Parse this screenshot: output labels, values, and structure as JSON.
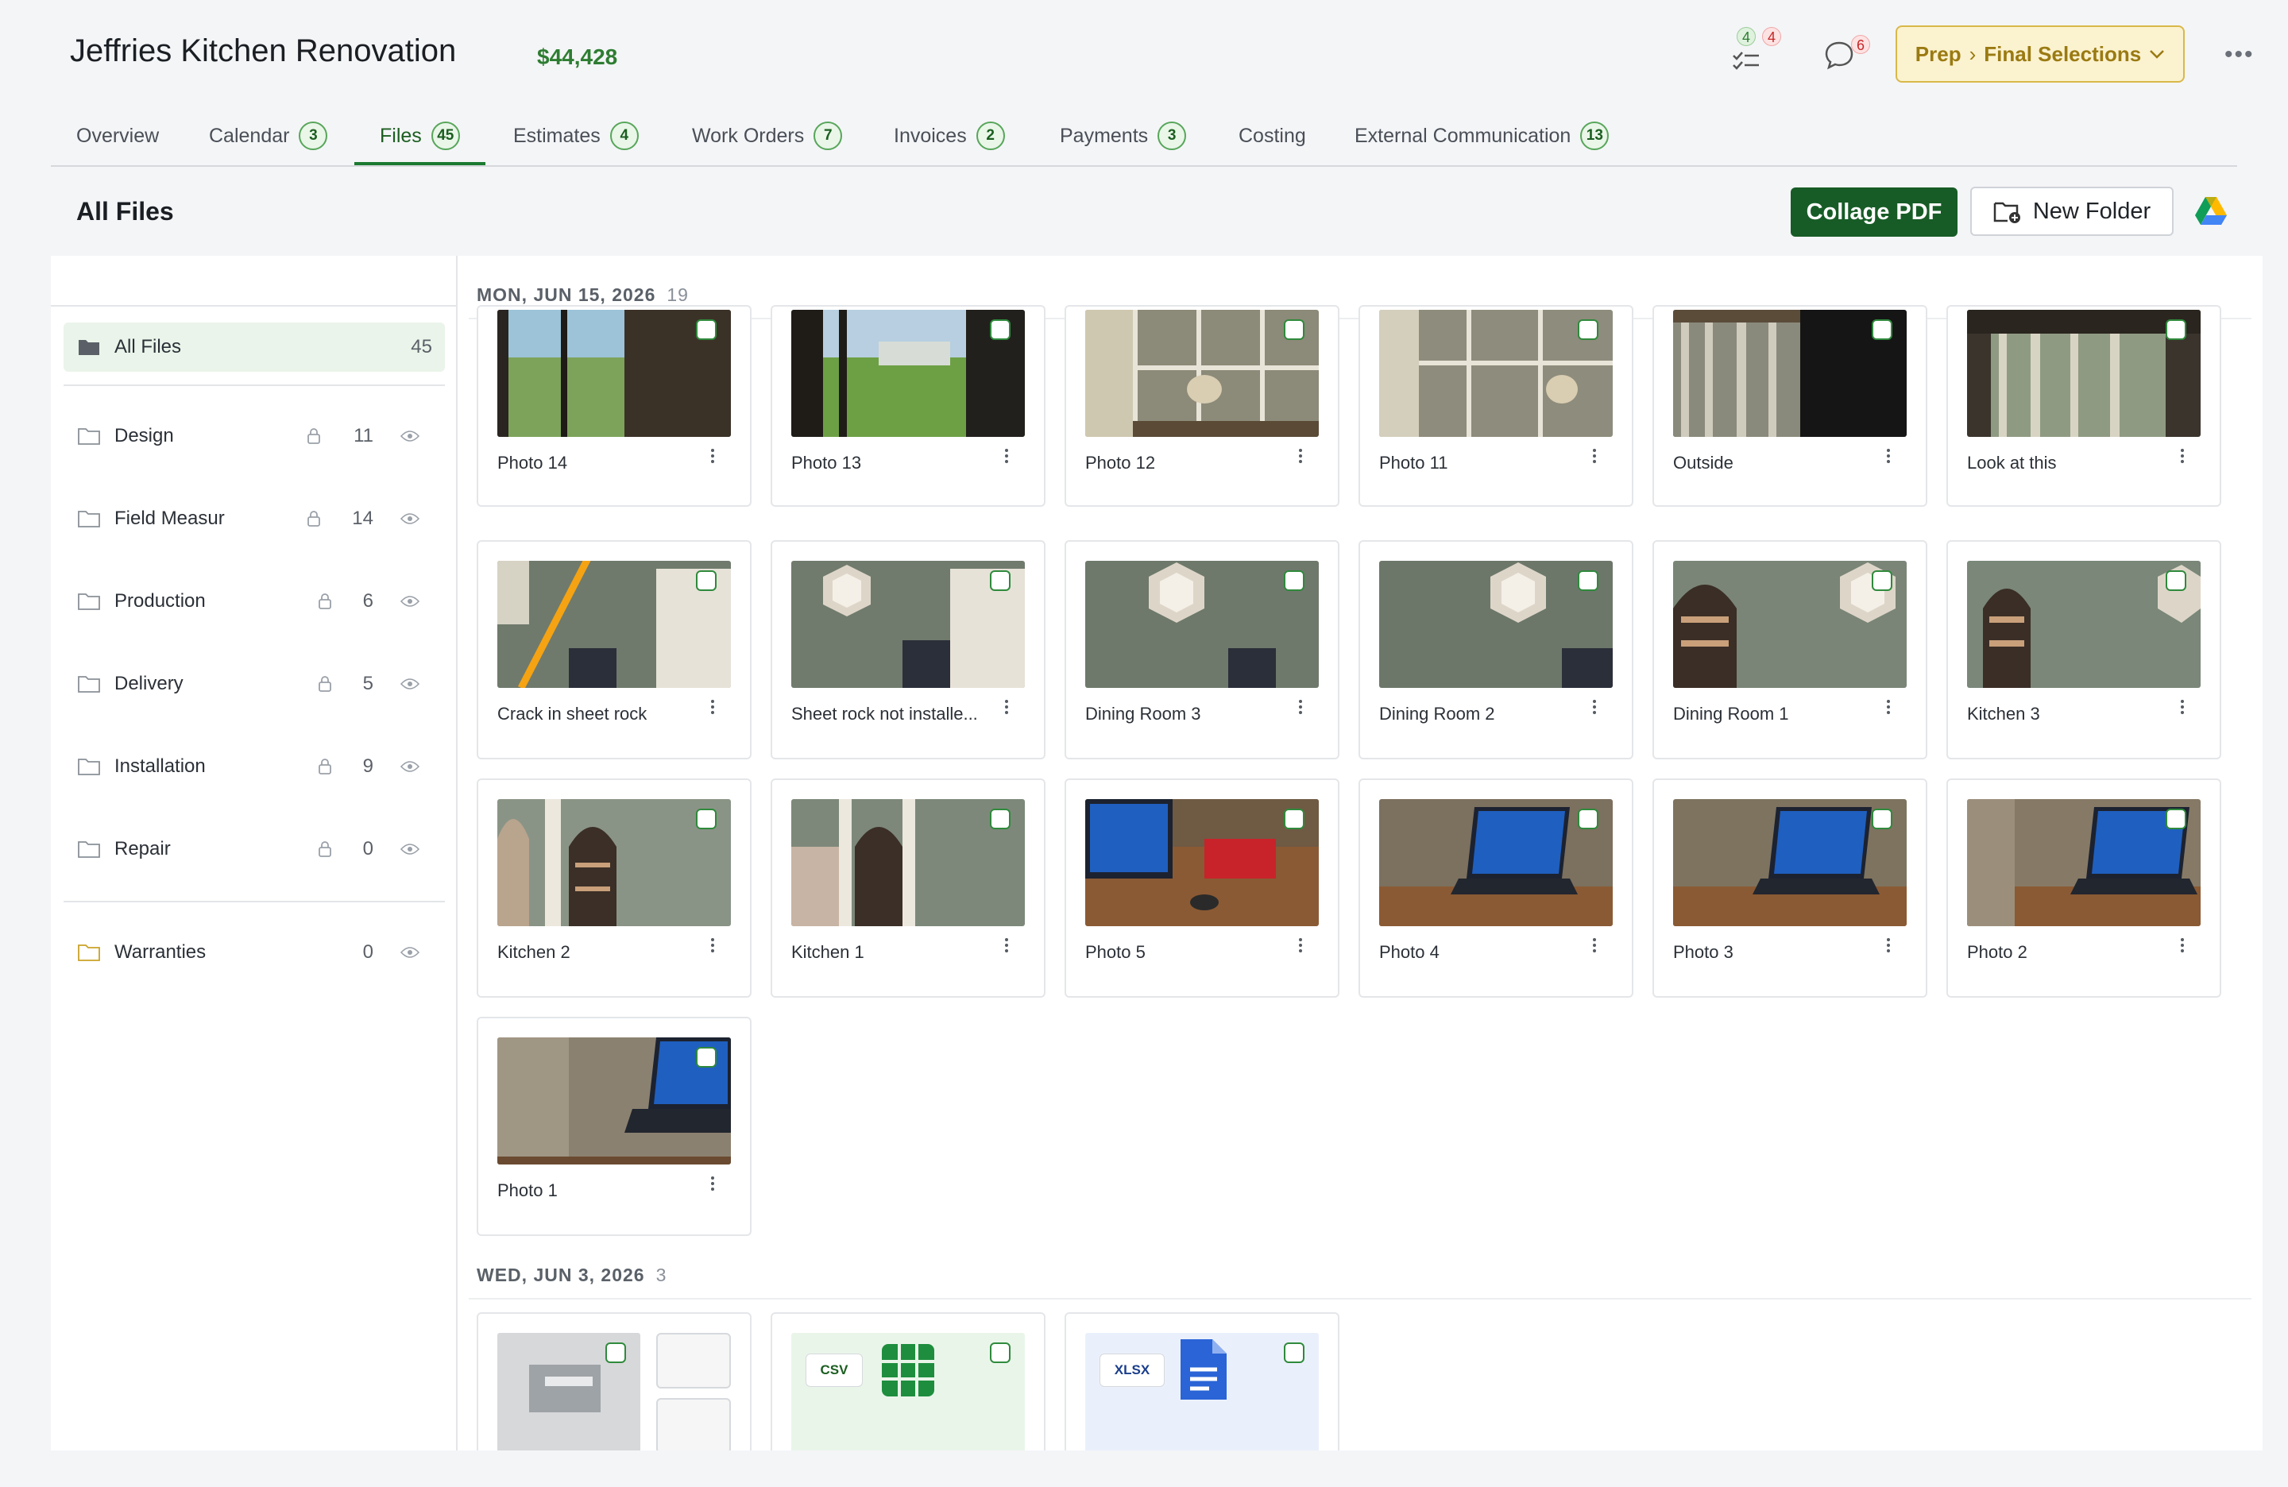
{
  "project": {
    "title": "Jeffries Kitchen Renovation",
    "amount": "$44,428"
  },
  "header": {
    "tasks_badges": [
      "4",
      "4"
    ],
    "messages_badge": "6",
    "stage_prefix": "Prep",
    "stage_separator": "›",
    "stage_label": "Final Selections"
  },
  "tabs": [
    {
      "label": "Overview",
      "count": ""
    },
    {
      "label": "Calendar",
      "count": "3"
    },
    {
      "label": "Files",
      "count": "45",
      "active": true
    },
    {
      "label": "Estimates",
      "count": "4"
    },
    {
      "label": "Work Orders",
      "count": "7"
    },
    {
      "label": "Invoices",
      "count": "2"
    },
    {
      "label": "Payments",
      "count": "3"
    },
    {
      "label": "Costing",
      "count": ""
    },
    {
      "label": "External Communication",
      "count": "13"
    }
  ],
  "section_title": "All Files",
  "actions": {
    "collage": "Collage PDF",
    "new_folder": "New Folder"
  },
  "sidebar": {
    "all": {
      "label": "All Files",
      "count": "45"
    },
    "folders": [
      {
        "label": "Design",
        "count": "11"
      },
      {
        "label": "Field Measur",
        "count": "14"
      },
      {
        "label": "Production",
        "count": "6"
      },
      {
        "label": "Delivery",
        "count": "5"
      },
      {
        "label": "Installation",
        "count": "9"
      },
      {
        "label": "Repair",
        "count": "0"
      }
    ],
    "warranties": {
      "label": "Warranties",
      "count": "0"
    }
  },
  "groups": [
    {
      "date": "MON, JUN 15, 2026",
      "count": "19",
      "files": [
        "Photo 14",
        "Photo 13",
        "Photo 12",
        "Photo 11",
        "Outside",
        "Look at this",
        "Crack in sheet rock",
        "Sheet rock not installe...",
        "Dining Room 3",
        "Dining Room 2",
        "Dining Room 1",
        "Kitchen 3",
        "Kitchen 2",
        "Kitchen 1",
        "Photo 5",
        "Photo 4",
        "Photo 3",
        "Photo 2",
        "Photo 1"
      ]
    },
    {
      "date": "WED, JUN 3, 2026",
      "count": "3",
      "file_tags": [
        "CSV",
        "XLSX"
      ]
    }
  ],
  "colors": {
    "accent": "#175c26",
    "stage_bg": "#fbf2cf",
    "stage_text": "#9a7a12"
  }
}
